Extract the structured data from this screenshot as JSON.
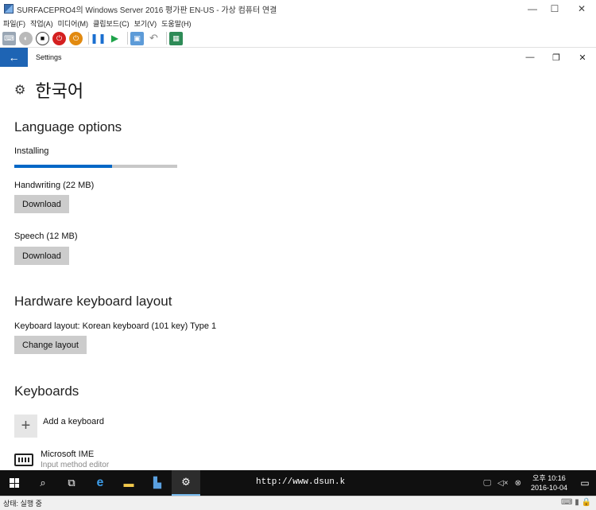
{
  "host": {
    "title": "SURFACEPRO4의 Windows Server 2016 평가판 EN-US - 가상 컴퓨터 연결",
    "menu": [
      "파일(F)",
      "작업(A)",
      "미디어(M)",
      "클립보드(C)",
      "보기(V)",
      "도움말(H)"
    ],
    "controls": {
      "minimize": "—",
      "maximize": "☐",
      "close": "✕"
    }
  },
  "settings": {
    "window_title": "Settings",
    "back_icon": "←",
    "controls": {
      "minimize": "—",
      "restore": "❐",
      "close": "✕"
    }
  },
  "page": {
    "title": "한국어",
    "language_options": {
      "heading": "Language options",
      "installing_label": "Installing",
      "progress": 0.6,
      "handwriting_label": "Handwriting (22 MB)",
      "handwriting_button": "Download",
      "speech_label": "Speech (12 MB)",
      "speech_button": "Download"
    },
    "hardware": {
      "heading": "Hardware keyboard layout",
      "layout_text": "Keyboard layout:  Korean keyboard (101 key) Type 1",
      "change_button": "Change layout"
    },
    "keyboards": {
      "heading": "Keyboards",
      "add_label": "Add a keyboard",
      "ime_name": "Microsoft IME",
      "ime_sub": "Input method editor"
    }
  },
  "taskbar": {
    "url": "http://www.dsun.k",
    "clock_time": "오후 10:16",
    "clock_date": "2016-10-04"
  },
  "statusbar": {
    "text": "상태: 실행 중"
  },
  "colors": {
    "accent": "#0067c6",
    "back_button": "#1e64b4",
    "taskbar": "#101010"
  }
}
